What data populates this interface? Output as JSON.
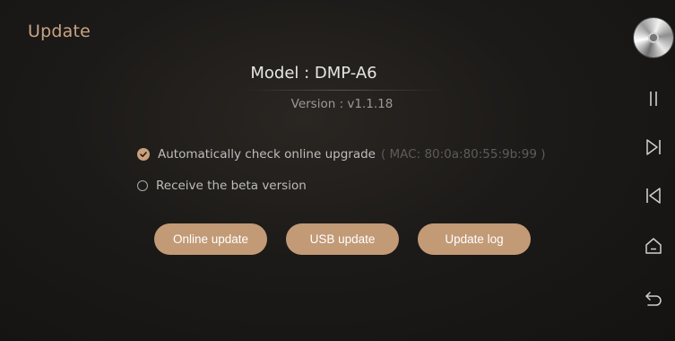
{
  "header": {
    "title": "Update"
  },
  "device": {
    "model": "Model : DMP-A6",
    "version": "Version : v1.1.18"
  },
  "options": {
    "auto_check": {
      "label": "Automatically check online upgrade",
      "mac": "( MAC: 80:0a:80:55:9b:99 )",
      "checked": true
    },
    "beta": {
      "label": "Receive the beta version",
      "checked": false
    }
  },
  "buttons": {
    "online_update": "Online update",
    "usb_update": "USB update",
    "update_log": "Update log"
  },
  "sidebar": {
    "icons": [
      "disc-icon",
      "pause-icon",
      "next-track-icon",
      "previous-track-icon",
      "home-icon",
      "back-icon"
    ]
  },
  "colors": {
    "accent": "#c29a76",
    "title": "#c8a483",
    "background": "#1c1a18"
  }
}
